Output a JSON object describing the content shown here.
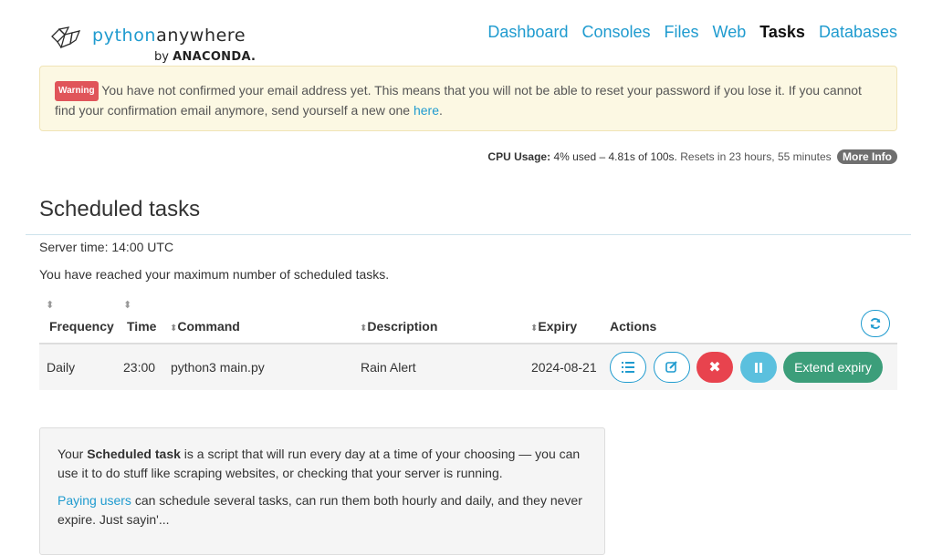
{
  "brand": {
    "name_part1": "python",
    "name_part2": "anywhere",
    "by": "by",
    "by_company": "ANACONDA."
  },
  "nav": {
    "items": [
      {
        "label": "Dashboard"
      },
      {
        "label": "Consoles"
      },
      {
        "label": "Files"
      },
      {
        "label": "Web"
      },
      {
        "label": "Tasks",
        "active": true
      },
      {
        "label": "Databases"
      }
    ]
  },
  "alert": {
    "badge": "Warning",
    "text": "You have not confirmed your email address yet. This means that you will not be able to reset your password if you lose it. If you cannot find your confirmation email anymore, send yourself a new one ",
    "link": "here",
    "end": "."
  },
  "cpu": {
    "label": "CPU Usage:",
    "value": "4% used – 4.81s of 100s.",
    "reset": "Resets in 23 hours, 55 minutes",
    "more_info": "More Info"
  },
  "page": {
    "title": "Scheduled tasks",
    "server_time": "Server time: 14:00 UTC",
    "max_message": "You have reached your maximum number of scheduled tasks."
  },
  "table": {
    "headers": {
      "frequency": "Frequency",
      "time": "Time",
      "command": "Command",
      "description": "Description",
      "expiry": "Expiry",
      "actions": "Actions"
    },
    "rows": [
      {
        "frequency": "Daily",
        "time": "23:00",
        "command": "python3 main.py",
        "description": "Rain Alert",
        "expiry": "2024-08-21",
        "extend_label": "Extend expiry"
      }
    ]
  },
  "info": {
    "p1_pre": "Your ",
    "p1_bold": "Scheduled task",
    "p1_post": " is a script that will run every day at a time of your choosing — you can use it to do stuff like scraping websites, or checking that your server is running.",
    "p2_link": "Paying users",
    "p2_post": " can schedule several tasks, can run them both hourly and daily, and they never expire. Just sayin'..."
  },
  "colors": {
    "accent": "#1f9bcf",
    "warning_bg": "#fcf8e3",
    "danger": "#e8434e",
    "info": "#5bc0de",
    "success": "#3c9e7a"
  },
  "icons": {
    "logo": "pythonanywhere-logo-icon",
    "sort": "sort-icon",
    "refresh": "refresh-icon",
    "log": "list-icon",
    "edit": "edit-icon",
    "delete": "close-icon",
    "pause": "pause-icon"
  }
}
